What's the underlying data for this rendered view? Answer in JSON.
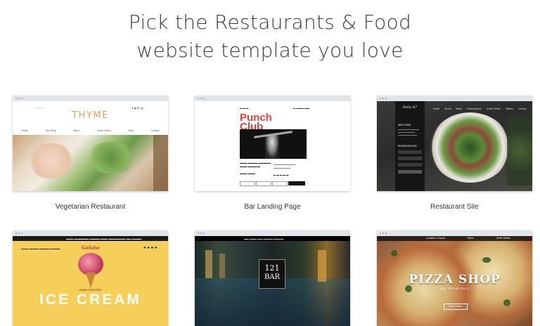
{
  "heading": {
    "line1": "Pick the Restaurants & Food",
    "line2": "website template you love"
  },
  "templates": [
    {
      "label": "Vegetarian Restaurant",
      "brand": "THYME",
      "nav": [
        "Home",
        "Our Story",
        "Menu",
        "Order Online",
        "Blog",
        "Contact"
      ]
    },
    {
      "label": "Bar Landing Page",
      "brand_line1": "Punch",
      "brand_line2": "Club"
    },
    {
      "label": "Restaurant Site",
      "brand": "Folio 47",
      "section": "WELCOME",
      "reserve": "RESERVATIONS",
      "nav": [
        "Home",
        "About",
        "Menu",
        "Reservations",
        "Order Online",
        "Gallery",
        "Contact"
      ]
    },
    {
      "label": "",
      "brand": "Gelato",
      "tagline": "HAND CRAFTED",
      "headline": "ICE CREAM"
    },
    {
      "label": "",
      "brand_line1": "121",
      "brand_line2": "BAR"
    },
    {
      "label": "",
      "headline": "PIZZA SHOP",
      "subline": "SAN FRANCISCO",
      "button": "Order Online",
      "nav": [
        "Location & Hours",
        "Menu",
        "Order Online"
      ]
    }
  ],
  "colors": {
    "heading": "#3b3b3b",
    "thyme_orange": "#e3a05c",
    "punch_red": "#e8403a",
    "gelato_yellow": "#f5cf5a",
    "dark_bg": "#1c1c1c"
  }
}
